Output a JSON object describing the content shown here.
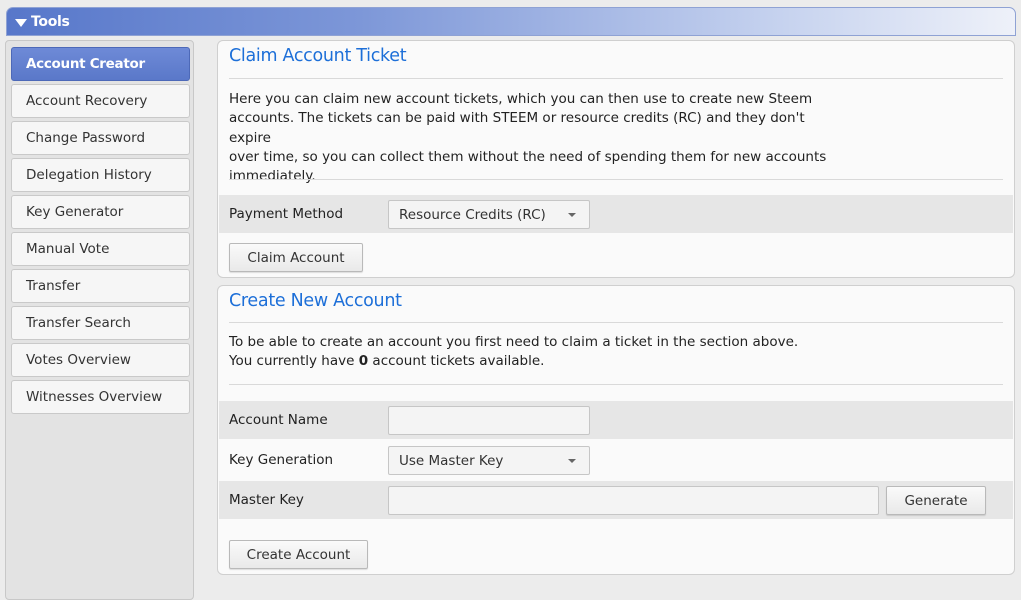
{
  "header": {
    "title": "Tools"
  },
  "sidebar": {
    "items": [
      {
        "label": "Account Creator",
        "active": true
      },
      {
        "label": "Account Recovery"
      },
      {
        "label": "Change Password"
      },
      {
        "label": "Delegation History"
      },
      {
        "label": "Key Generator"
      },
      {
        "label": "Manual Vote"
      },
      {
        "label": "Transfer"
      },
      {
        "label": "Transfer Search"
      },
      {
        "label": "Votes Overview"
      },
      {
        "label": "Witnesses Overview"
      }
    ]
  },
  "claim": {
    "title": "Claim Account Ticket",
    "description_lines": [
      "Here you can claim new account tickets, which you can then use to create new Steem",
      "accounts. The tickets can be paid with STEEM or resource credits (RC) and they don't expire",
      "over time, so you can collect them without the need of spending them for new accounts",
      "immediately."
    ],
    "payment_method_label": "Payment Method",
    "payment_method_value": "Resource Credits (RC)",
    "claim_button": "Claim Account"
  },
  "create": {
    "title": "Create New Account",
    "line1": "To be able to create an account you first need to claim a ticket in the section above.",
    "line2_prefix": "You currently have ",
    "ticket_count": "0",
    "line2_suffix": " account tickets available.",
    "account_name_label": "Account Name",
    "account_name_value": "",
    "key_generation_label": "Key Generation",
    "key_generation_value": "Use Master Key",
    "master_key_label": "Master Key",
    "master_key_value": "",
    "generate_button": "Generate",
    "create_button": "Create Account"
  }
}
